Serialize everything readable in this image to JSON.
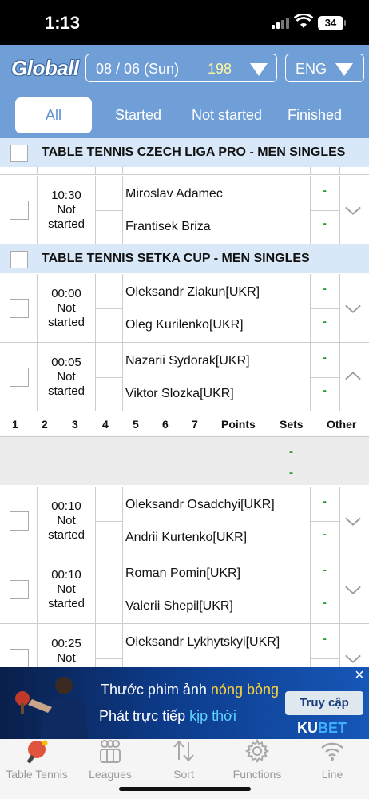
{
  "status": {
    "time": "1:13",
    "battery": "34"
  },
  "header": {
    "logo": "Globall",
    "date": "08 / 06 (Sun)",
    "count": "198",
    "lang": "ENG"
  },
  "tabs": [
    {
      "label": "All",
      "active": true
    },
    {
      "label": "Started"
    },
    {
      "label": "Not started"
    },
    {
      "label": "Finished"
    }
  ],
  "leagues": [
    {
      "name": "TABLE TENNIS CZECH LIGA PRO - MEN SINGLES"
    },
    {
      "name": "TABLE TENNIS SETKA CUP - MEN SINGLES"
    }
  ],
  "matches": [
    {
      "time": "10:30",
      "status": "Not started",
      "player1": "Miroslav Adamec",
      "player2": "Frantisek Briza",
      "score1": "-",
      "score2": "-",
      "expanded": false
    },
    {
      "time": "00:00",
      "status": "Not started",
      "player1": "Oleksandr Ziakun[UKR]",
      "player2": "Oleg Kurilenko[UKR]",
      "score1": "-",
      "score2": "-",
      "expanded": false
    },
    {
      "time": "00:05",
      "status": "Not started",
      "player1": "Nazarii Sydorak[UKR]",
      "player2": "Viktor Slozka[UKR]",
      "score1": "-",
      "score2": "-",
      "expanded": true
    },
    {
      "time": "00:10",
      "status": "Not started",
      "player1": "Oleksandr Osadchyi[UKR]",
      "player2": "Andrii Kurtenko[UKR]",
      "score1": "-",
      "score2": "-",
      "expanded": false
    },
    {
      "time": "00:10",
      "status": "Not started",
      "player1": "Roman Pomin[UKR]",
      "player2": "Valerii Shepil[UKR]",
      "score1": "-",
      "score2": "-",
      "expanded": false
    },
    {
      "time": "00:25",
      "status": "Not",
      "player1": "Oleksandr Lykhytskyi[UKR]",
      "player2": "",
      "score1": "-",
      "score2": "",
      "expanded": false
    }
  ],
  "score_table": {
    "headers": [
      "1",
      "2",
      "3",
      "4",
      "5",
      "6",
      "7",
      "Points",
      "Sets",
      "Other"
    ],
    "row1": "-",
    "row2": "-"
  },
  "ad": {
    "line1_a": "Thước phim ảnh ",
    "line1_b": "nóng bỏng",
    "line2_a": "Phát trực tiếp ",
    "line2_b": "kịp thời",
    "cta": "Truy cập",
    "brand_a": "KU",
    "brand_b": "BET",
    "close": "×"
  },
  "nav": [
    {
      "label": "Table Tennis",
      "icon": "table-tennis-icon"
    },
    {
      "label": "Leagues",
      "icon": "leagues-icon"
    },
    {
      "label": "Sort",
      "icon": "sort-icon"
    },
    {
      "label": "Functions",
      "icon": "gear-icon"
    },
    {
      "label": "Line",
      "icon": "wifi-signal-icon"
    }
  ],
  "colors": {
    "header": "#6f9fd6",
    "league_bg": "#d9e8f8",
    "score": "#2a9a2a"
  }
}
